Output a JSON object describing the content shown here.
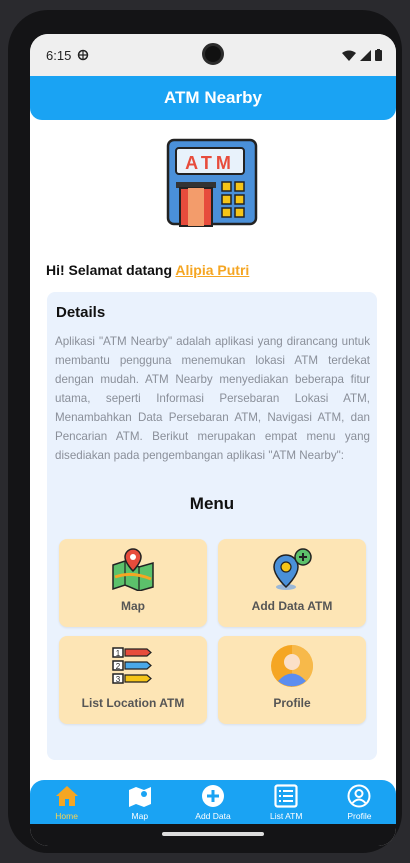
{
  "status": {
    "time": "6:15"
  },
  "app": {
    "title": "ATM Nearby"
  },
  "greeting": {
    "prefix": "Hi! Selamat datang",
    "user": "Alipia Putri"
  },
  "details": {
    "title": "Details",
    "text": "Aplikasi \"ATM Nearby\" adalah aplikasi yang dirancang untuk membantu pengguna menemukan lokasi ATM terdekat dengan mudah. ATM Nearby menyediakan beberapa fitur utama, seperti Informasi Persebaran Lokasi ATM, Menambahkan Data Persebaran ATM, Navigasi ATM, dan Pencarian ATM. Berikut merupakan empat menu yang disediakan pada pengembangan aplikasi \"ATM Nearby\":"
  },
  "logo": {
    "text": "ATM"
  },
  "menu": {
    "title": "Menu",
    "items": [
      {
        "label": "Map",
        "icon": "map-pin-icon"
      },
      {
        "label": "Add Data ATM",
        "icon": "add-location-icon"
      },
      {
        "label": "List Location ATM",
        "icon": "numbered-list-icon"
      },
      {
        "label": "Profile",
        "icon": "user-avatar-icon"
      }
    ]
  },
  "nav": {
    "items": [
      {
        "label": "Home",
        "icon": "home-icon",
        "active": true
      },
      {
        "label": "Map",
        "icon": "map-icon"
      },
      {
        "label": "Add Data",
        "icon": "plus-circle-icon"
      },
      {
        "label": "List ATM",
        "icon": "list-icon"
      },
      {
        "label": "Profile",
        "icon": "profile-icon"
      }
    ]
  },
  "colors": {
    "primary": "#1aa3f3",
    "accent": "#f5a623",
    "card": "#fde5b5",
    "panel": "#eaf2fd"
  }
}
